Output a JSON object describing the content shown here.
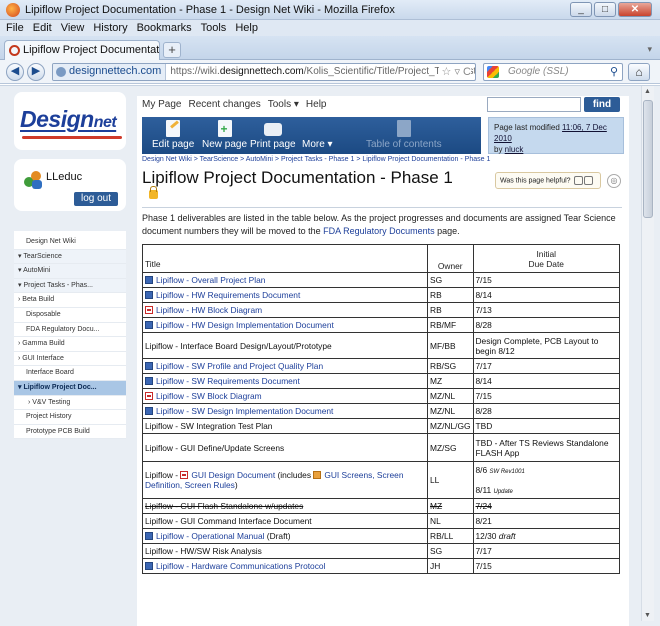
{
  "window": {
    "title": "Lipiflow Project Documentation - Phase 1 - Design Net Wiki - Mozilla Firefox",
    "min": "_",
    "max": "□",
    "close": "✕"
  },
  "menu": [
    "File",
    "Edit",
    "View",
    "History",
    "Bookmarks",
    "Tools",
    "Help"
  ],
  "tab": {
    "label": "Lipiflow Project Documentation - Phase ...",
    "close": "×",
    "new": "+"
  },
  "nav": {
    "back": "◀",
    "forward": "▶",
    "site": "designnettech.com",
    "url_prefix": "https://wiki.",
    "url_domain": "designnettech.com",
    "url_path": "/Kolis_Scientific/Title/Project_Task_Lists/Lipiflow_Project_Docu",
    "search_placeholder": "Google (SSL)",
    "home": "⌂"
  },
  "sidebar": {
    "logo_main": "Design",
    "logo_sub": "net",
    "user": "LLeduc",
    "logout": "log out",
    "items": [
      {
        "label": "Design Net Wiki",
        "cls": "l1"
      },
      {
        "label": "▾ TearScience",
        "cls": "exp"
      },
      {
        "label": "▾ AutoMini",
        "cls": "exp"
      },
      {
        "label": "▾ Project Tasks - Phas...",
        "cls": "exp"
      },
      {
        "label": "› Beta Build",
        "cls": ""
      },
      {
        "label": "Disposable",
        "cls": "l1"
      },
      {
        "label": "FDA Regulatory Docu...",
        "cls": "l1"
      },
      {
        "label": "› Gamma Build",
        "cls": ""
      },
      {
        "label": "› GUI Interface",
        "cls": ""
      },
      {
        "label": "Interface Board",
        "cls": "l1"
      },
      {
        "label": "▾ Lipiflow Project Doc...",
        "cls": "active"
      },
      {
        "label": "› V&V Testing",
        "cls": "l2"
      },
      {
        "label": "Project History",
        "cls": "l1"
      },
      {
        "label": "Prototype PCB Build",
        "cls": "l1"
      }
    ]
  },
  "topnav": {
    "my_page": "My Page",
    "recent": "Recent changes",
    "tools": "Tools ▾",
    "help": "Help",
    "find": "find"
  },
  "toolbar": {
    "edit": "Edit page",
    "new": "New page",
    "print": "Print page",
    "more": "More ▾",
    "toc": "Table of contents"
  },
  "modified": {
    "prefix": "Page last modified ",
    "when": "11:06, 7 Dec 2010",
    "by_prefix": "by ",
    "by": "nluck"
  },
  "breadcrumb": "Design Net Wiki > TearScience > AutoMini > Project Tasks - Phase 1 > Lipiflow Project Documentation - Phase 1",
  "page_title": "Lipiflow Project Documentation - Phase 1",
  "helpful": "Was this page helpful?",
  "intro": {
    "text": "Phase 1 deliverables are listed in the table below. As the project progresses and documents are assigned Tear Science document numbers they will be moved to the ",
    "link": "FDA Regulatory Documents",
    "suffix": " page."
  },
  "table": {
    "headers": {
      "title": "Title",
      "owner": "Owner",
      "due1": "Initial",
      "due2": "Due Date"
    },
    "rows": [
      {
        "icon": "word",
        "title": "Lipiflow - Overall Project Plan",
        "link": true,
        "owner": "SG",
        "due": "7/15"
      },
      {
        "icon": "word",
        "title": "Lipiflow - HW Requirements Document",
        "link": true,
        "owner": "RB",
        "due": "8/14"
      },
      {
        "icon": "pdf",
        "title": "Lipiflow - HW Block Diagram",
        "link": true,
        "owner": "RB",
        "due": "7/13"
      },
      {
        "icon": "word",
        "title": "Lipiflow - HW Design Implementation Document",
        "link": true,
        "owner": "RB/MF",
        "due": "8/28"
      },
      {
        "icon": "",
        "title": "Lipiflow - Interface Board Design/Layout/Prototype",
        "link": false,
        "owner": "MF/BB",
        "due": "Design Complete, PCB Layout to begin 8/12"
      },
      {
        "icon": "word",
        "title": "Lipiflow - SW Profile and Project Quality Plan",
        "link": true,
        "owner": "RB/SG",
        "due": "7/17"
      },
      {
        "icon": "word",
        "title": "Lipiflow - SW Requirements Document",
        "link": true,
        "owner": "MZ",
        "due": "8/14"
      },
      {
        "icon": "pdf",
        "title": "Lipiflow - SW Block Diagram",
        "link": true,
        "owner": "MZ/NL",
        "due": "7/15"
      },
      {
        "icon": "word",
        "title": "Lipiflow - SW Design Implementation Document",
        "link": true,
        "owner": "MZ/NL",
        "due": "8/28"
      },
      {
        "icon": "",
        "title": "Lipiflow - SW Integration Test Plan",
        "link": false,
        "owner": "MZ/NL/GG",
        "due": "TBD"
      },
      {
        "icon": "",
        "title": "Lipiflow - GUI Define/Update Screens",
        "link": false,
        "owner": "MZ/SG",
        "due": "TBD - After TS Reviews Standalone FLASH App"
      }
    ],
    "gui_row": {
      "prefix": "Lipiflow - ",
      "doc": "GUI Design Document",
      "mid": " (includes ",
      "screens": "GUI Screens, Screen Definition, Screen Rules",
      "end": ")",
      "owner": "LL",
      "due_a": "8/6",
      "due_a_note": "SW Rev1001",
      "due_b": "8/11",
      "due_b_note": "Update"
    },
    "rows2": [
      {
        "icon": "",
        "title": "Lipiflow - GUI Flash Standalone w/updates",
        "link": false,
        "strike": true,
        "owner": "MZ",
        "due": "7/24"
      },
      {
        "icon": "",
        "title": "Lipiflow - GUI Command Interface Document",
        "link": false,
        "owner": "NL",
        "due": "8/21"
      },
      {
        "icon": "word",
        "title": "Lipiflow - Operational Manual",
        "suffix": " (Draft)",
        "link": true,
        "owner": "RB/LL",
        "due": "12/30",
        "due_note": " draft"
      },
      {
        "icon": "",
        "title": "Lipiflow - HW/SW Risk Analysis",
        "link": false,
        "owner": "SG",
        "due": "7/17"
      },
      {
        "icon": "word",
        "title": "Lipiflow - Hardware Communications Protocol",
        "link": true,
        "owner": "JH",
        "due": "7/15"
      }
    ]
  }
}
